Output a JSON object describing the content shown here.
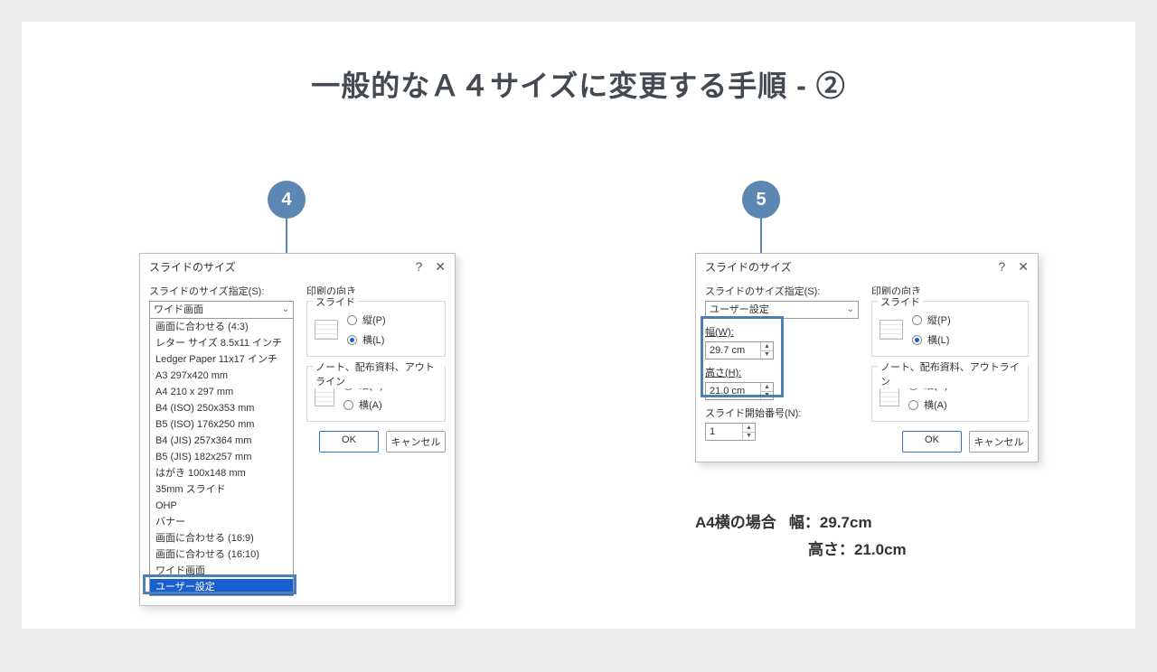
{
  "title": "一般的なＡ４サイズに変更する手順 - ②",
  "step4": {
    "badge": "4",
    "dialog_title": "スライドのサイズ",
    "size_label": "スライドのサイズ指定(S):",
    "combo_value": "ワイド画面",
    "dropdown_items": [
      "画面に合わせる (4:3)",
      "レター サイズ 8.5x11 インチ",
      "Ledger Paper 11x17 インチ",
      "A3 297x420 mm",
      "A4 210 x 297 mm",
      "B4 (ISO) 250x353 mm",
      "B5 (ISO) 176x250 mm",
      "B4 (JIS) 257x364 mm",
      "B5 (JIS) 182x257 mm",
      "はがき 100x148 mm",
      "35mm スライド",
      "OHP",
      "バナー",
      "画面に合わせる (16:9)",
      "画面に合わせる (16:10)",
      "ワイド画面",
      "ユーザー設定"
    ],
    "print_orient": "印刷の向き",
    "slide_label": "スライド",
    "portrait": "縦(P)",
    "landscape": "横(L)",
    "notes_label": "ノート、配布資料、アウトライン",
    "n_portrait": "縦(O)",
    "n_landscape": "横(A)",
    "ok": "OK",
    "cancel": "キャンセル"
  },
  "step5": {
    "badge": "5",
    "dialog_title": "スライドのサイズ",
    "size_label": "スライドのサイズ指定(S):",
    "combo_value": "ユーザー設定",
    "width_label": "幅(W):",
    "width_value": "29.7 cm",
    "height_label": "高さ(H):",
    "height_value": "21.0 cm",
    "start_label": "スライド開始番号(N):",
    "start_value": "1",
    "print_orient": "印刷の向き",
    "slide_label": "スライド",
    "portrait": "縦(P)",
    "landscape": "横(L)",
    "notes_label": "ノート、配布資料、アウトライン",
    "n_portrait": "縦(O)",
    "n_landscape": "横(A)",
    "ok": "OK",
    "cancel": "キャンセル"
  },
  "caption": {
    "line1a": "A4横の場合",
    "line1b": "幅：29.7cm",
    "line2": "高さ：21.0cm"
  }
}
